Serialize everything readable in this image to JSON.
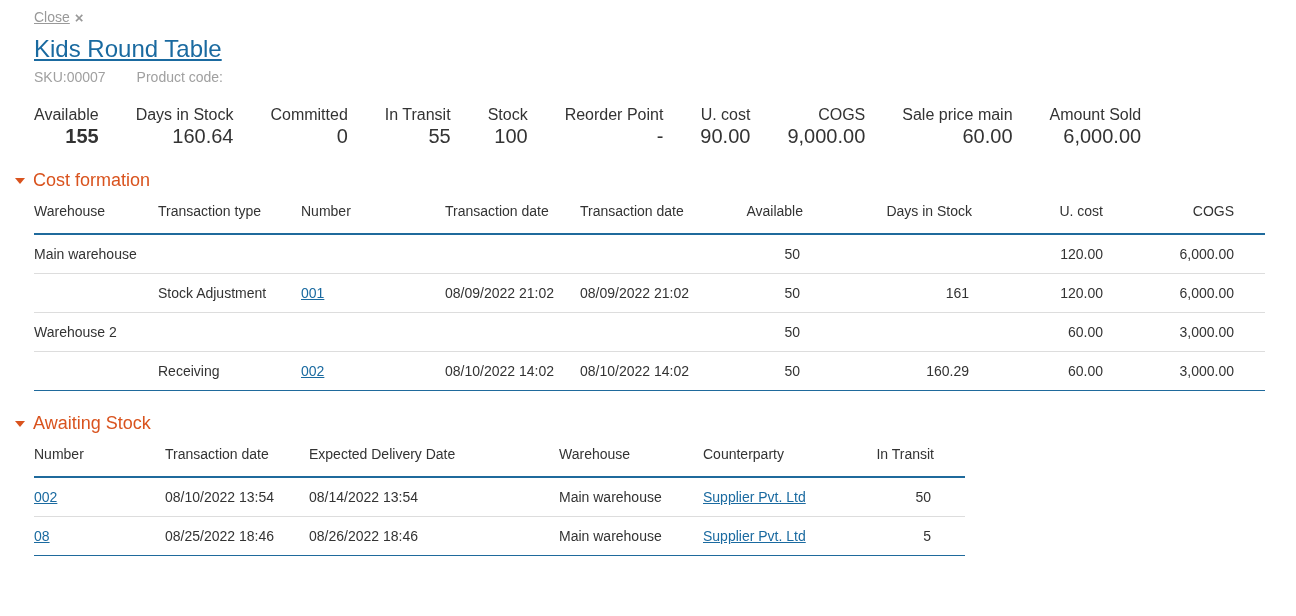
{
  "close": {
    "label": "Close",
    "icon": "×"
  },
  "title": "Kids Round Table",
  "meta": [
    "SKU:00007",
    "Product code:"
  ],
  "stats": [
    {
      "label": "Available",
      "value": "155",
      "bold": true
    },
    {
      "label": "Days in Stock",
      "value": "160.64",
      "bold": false
    },
    {
      "label": "Committed",
      "value": "0",
      "bold": false
    },
    {
      "label": "In Transit",
      "value": "55",
      "bold": false
    },
    {
      "label": "Stock",
      "value": "100",
      "bold": false
    },
    {
      "label": "Reorder Point",
      "value": "-",
      "bold": false
    },
    {
      "label": "U. cost",
      "value": "90.00",
      "bold": false
    },
    {
      "label": "COGS",
      "value": "9,000.00",
      "bold": false
    },
    {
      "label": "Sale price main",
      "value": "60.00",
      "bold": false
    },
    {
      "label": "Amount Sold",
      "value": "6,000.00",
      "bold": false
    }
  ],
  "sections": [
    {
      "title": "Cost formation",
      "expanded": true,
      "table": {
        "columns": [
          {
            "label": "Warehouse",
            "kind": "text"
          },
          {
            "label": "Transaction type",
            "kind": "text"
          },
          {
            "label": "Number",
            "kind": "link"
          },
          {
            "label": "Transaction date",
            "kind": "text"
          },
          {
            "label": "Transaction date",
            "kind": "text"
          },
          {
            "label": "Available",
            "kind": "number"
          },
          {
            "label": "Days in Stock",
            "kind": "number"
          },
          {
            "label": "U. cost",
            "kind": "number"
          },
          {
            "label": "COGS",
            "kind": "number"
          }
        ],
        "rows": [
          [
            "Main warehouse",
            null,
            null,
            null,
            null,
            "50",
            null,
            "120.00",
            "6,000.00"
          ],
          [
            null,
            "Stock Adjustment",
            "001",
            "08/09/2022 21:02",
            "08/09/2022 21:02",
            "50",
            "161",
            "120.00",
            "6,000.00"
          ],
          [
            "Warehouse 2",
            null,
            null,
            null,
            null,
            "50",
            null,
            "60.00",
            "3,000.00"
          ],
          [
            null,
            "Receiving",
            "002",
            "08/10/2022 14:02",
            "08/10/2022 14:02",
            "50",
            "160.29",
            "60.00",
            "3,000.00"
          ]
        ]
      }
    },
    {
      "title": "Awaiting Stock",
      "expanded": true,
      "table": {
        "columns": [
          {
            "label": "Number",
            "kind": "link"
          },
          {
            "label": "Transaction date",
            "kind": "text"
          },
          {
            "label": "Expected Delivery Date",
            "kind": "text"
          },
          {
            "label": "Warehouse",
            "kind": "text"
          },
          {
            "label": "Counterparty",
            "kind": "link"
          },
          {
            "label": "In Transit",
            "kind": "number"
          }
        ],
        "rows": [
          [
            "002",
            "08/10/2022 13:54",
            "08/14/2022 13:54",
            "Main warehouse",
            "Supplier Pvt. Ltd",
            "50"
          ],
          [
            "08",
            "08/25/2022 18:46",
            "08/26/2022 18:46",
            "Main warehouse",
            "Supplier Pvt. Ltd",
            "5"
          ]
        ]
      }
    }
  ]
}
